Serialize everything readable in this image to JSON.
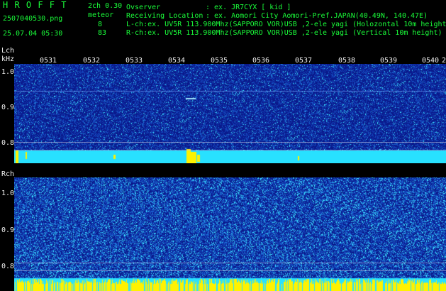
{
  "header": {
    "app_name": "H R O F F T",
    "settings": "2ch 0.30",
    "event_type": "meteor",
    "filename": "2507040530.png",
    "datetime": "25.07.04 05:30",
    "count_l": "8",
    "count_r": "83",
    "observer_label": "Ovserver",
    "observer_value": ": ex. JR7CYX [ kid ]",
    "location_label": "Receiving Location",
    "location_value": ": ex. Aomori City Aomori-Pref.JAPAN(40.49N, 140.47E)",
    "lch_info": "L-ch:ex. UV5R 113.900Mhz(SAPPORO VOR)USB ,2-ele yagi (Holozontal 10m height",
    "rch_info": "R-ch:ex. UV5R 113.900Mhz(SAPPORO VOR)USB ,2-ele yagi (Vertical 10m height)"
  },
  "time_ticks": [
    "0531",
    "0532",
    "0533",
    "0534",
    "0535",
    "0536",
    "0537",
    "0538",
    "0539",
    "0540",
    "2"
  ],
  "left_panel": {
    "label": "Lch",
    "unit": "kHz",
    "y_ticks": [
      "1.0",
      "0.9",
      "0.8"
    ]
  },
  "right_panel": {
    "label": "Rch",
    "y_ticks": [
      "1.0",
      "0.9",
      "0.8"
    ]
  },
  "colors": {
    "header_green": "#1aff3a",
    "header_white": "#f2f2f2",
    "spectrogram_bg": "#0a1a8c",
    "noise_cyan": "#27e0ff",
    "signal_yellow": "#fff200"
  }
}
